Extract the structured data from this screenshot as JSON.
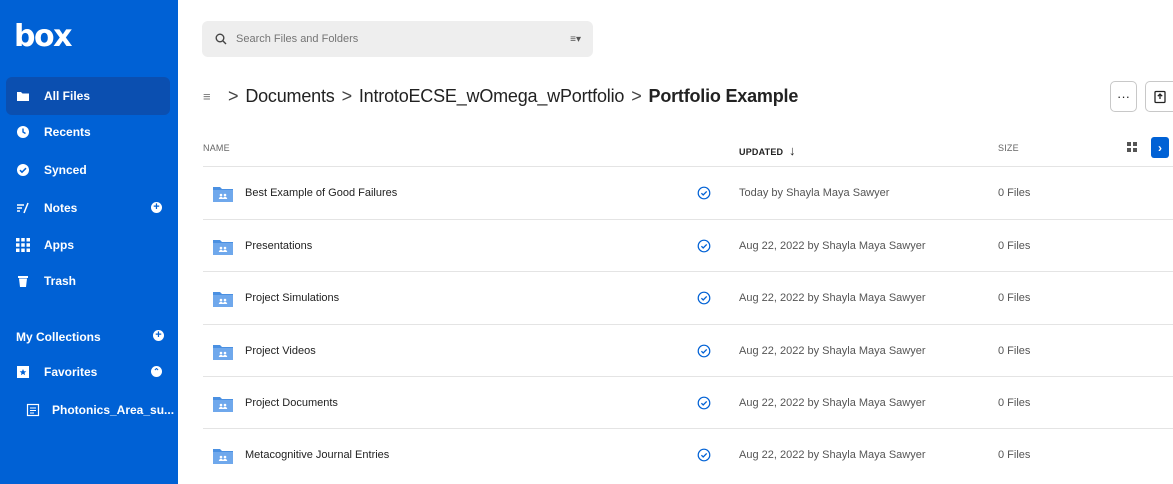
{
  "brand": {
    "logo": "box"
  },
  "sidebar": {
    "items": [
      {
        "label": "All Files",
        "icon": "folder-icon"
      },
      {
        "label": "Recents",
        "icon": "clock-icon"
      },
      {
        "label": "Synced",
        "icon": "check-circle-icon"
      },
      {
        "label": "Notes",
        "icon": "notes-icon"
      },
      {
        "label": "Apps",
        "icon": "apps-grid-icon"
      },
      {
        "label": "Trash",
        "icon": "trash-icon"
      }
    ],
    "collections_label": "My Collections",
    "favorites_label": "Favorites",
    "favorite_items": [
      {
        "label": "Photonics_Area_su...",
        "icon": "file-icon"
      }
    ]
  },
  "search": {
    "placeholder": "Search Files and Folders"
  },
  "breadcrumb": {
    "items": [
      "Documents",
      "IntrotoECSE_wOmega_wPortfolio"
    ],
    "current": "Portfolio Example",
    "separator": ">"
  },
  "toolbar": {
    "more_label": "···"
  },
  "table": {
    "columns": {
      "name": "NAME",
      "updated": "UPDATED",
      "sort_arrow": "↓",
      "size": "SIZE"
    },
    "rows": [
      {
        "name": "Best Example of Good Failures",
        "updated": "Today by Shayla Maya Sawyer",
        "size": "0 Files"
      },
      {
        "name": "Presentations",
        "updated": "Aug 22, 2022 by Shayla Maya Sawyer",
        "size": "0 Files"
      },
      {
        "name": "Project Simulations",
        "updated": "Aug 22, 2022 by Shayla Maya Sawyer",
        "size": "0 Files"
      },
      {
        "name": "Project Videos",
        "updated": "Aug 22, 2022 by Shayla Maya Sawyer",
        "size": "0 Files"
      },
      {
        "name": "Project Documents",
        "updated": "Aug 22, 2022 by Shayla Maya Sawyer",
        "size": "0 Files"
      },
      {
        "name": "Metacognitive Journal Entries",
        "updated": "Aug 22, 2022 by Shayla Maya Sawyer",
        "size": "0 Files"
      }
    ]
  },
  "colors": {
    "brand": "#0061d5",
    "active_nav": "#0b4fb0",
    "folder": "#4a90e2"
  }
}
